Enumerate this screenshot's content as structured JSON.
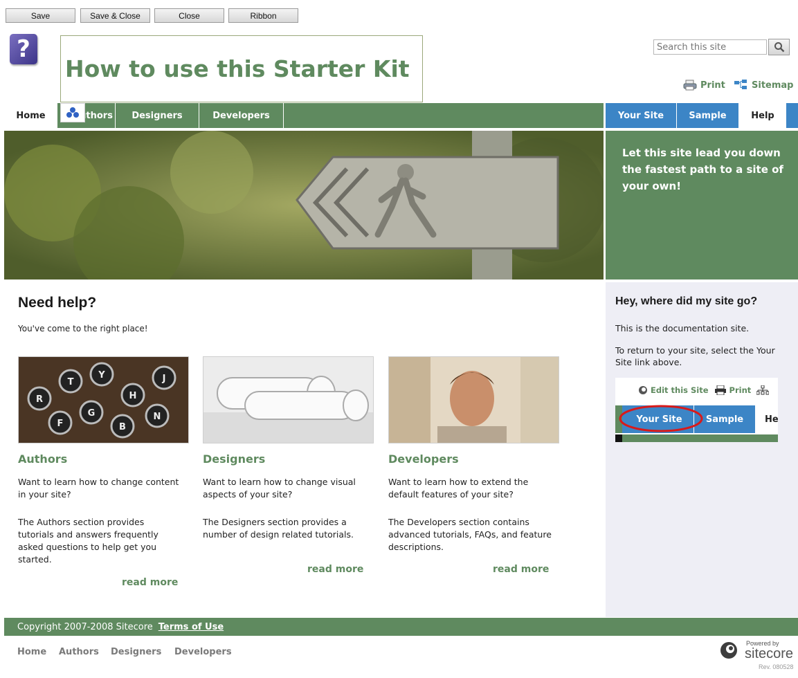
{
  "toolbar": {
    "save": "Save",
    "save_close": "Save & Close",
    "close": "Close",
    "ribbon": "Ribbon"
  },
  "page_title": "How to use this Starter Kit",
  "search": {
    "placeholder": "Search this site"
  },
  "utility": {
    "print": "Print",
    "sitemap": "Sitemap"
  },
  "nav": {
    "home": "Home",
    "authors": "Authors",
    "designers": "Designers",
    "developers": "Developers"
  },
  "right_nav": {
    "your_site": "Your Site",
    "sample": "Sample",
    "help": "Help"
  },
  "promo_text": "Let this site lead you down the fastest path to a site of your own!",
  "main": {
    "heading": "Need help?",
    "lead": "You've come to the right place!",
    "cards": [
      {
        "title": "Authors",
        "p1": "Want to learn how to change content in your site?",
        "p2": "The Authors section provides tutorials and answers frequently asked questions to help get you started.",
        "more": "read more"
      },
      {
        "title": "Designers",
        "p1": "Want to learn how to change visual aspects of your site?",
        "p2": "The Designers section provides a number of design related tutorials.",
        "more": "read more"
      },
      {
        "title": "Developers",
        "p1": "Want to learn how to extend the default features of your site?",
        "p2": "The Developers section contains advanced tutorials, FAQs, and feature descriptions.",
        "more": "read more"
      }
    ]
  },
  "sidebar": {
    "heading": "Hey, where did my site go?",
    "p1": "This is the documentation site.",
    "p2": "To return to your site, select the Your Site link above.",
    "mini": {
      "edit": "Edit this Site",
      "print": "Print",
      "your_site": "Your Site",
      "sample": "Sample",
      "help_partial": "He"
    }
  },
  "footer": {
    "copyright": "Copyright  2007-2008  Sitecore",
    "terms": "Terms of Use",
    "links": [
      "Home",
      "Authors",
      "Designers",
      "Developers"
    ],
    "powered_by": "Powered by",
    "brand": "sitecore",
    "rev": "Rev. 080528"
  },
  "colors": {
    "green": "#5f8a5f",
    "blue": "#3c85c6",
    "sidebar_bg": "#eeeef5"
  }
}
